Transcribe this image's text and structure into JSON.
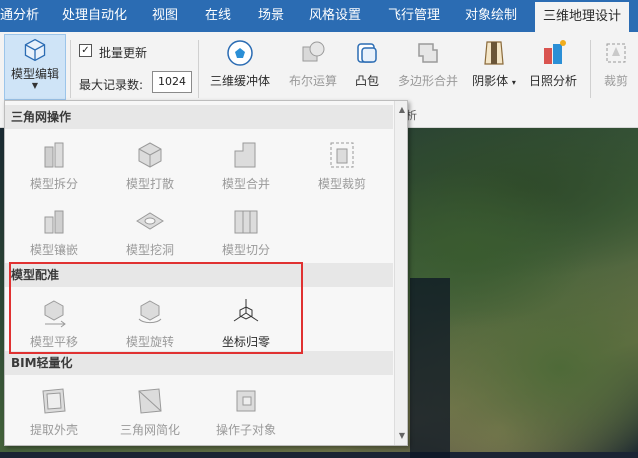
{
  "tabs": [
    {
      "label": "通分析",
      "active": false
    },
    {
      "label": "处理自动化",
      "active": false
    },
    {
      "label": "视图",
      "active": false
    },
    {
      "label": "在线",
      "active": false
    },
    {
      "label": "场景",
      "active": false
    },
    {
      "label": "风格设置",
      "active": false
    },
    {
      "label": "飞行管理",
      "active": false
    },
    {
      "label": "对象绘制",
      "active": false
    },
    {
      "label": "三维地理设计",
      "active": true
    }
  ],
  "ribbon": {
    "model_edit_label": "模型编辑",
    "batch_update_label": "批量更新",
    "batch_update_checked": true,
    "max_records_label": "最大记录数:",
    "max_records_value": "1024",
    "group_label_suffix": "析",
    "buttons": [
      {
        "label": "三维缓冲体",
        "enabled": true,
        "icon": "buffer-icon"
      },
      {
        "label": "布尔运算",
        "enabled": false,
        "icon": "boolean-icon"
      },
      {
        "label": "凸包",
        "enabled": true,
        "icon": "convex-hull-icon"
      },
      {
        "label": "多边形合并",
        "enabled": false,
        "icon": "polygon-merge-icon"
      },
      {
        "label": "阴影体",
        "enabled": true,
        "icon": "shadow-volume-icon"
      },
      {
        "label": "日照分析",
        "enabled": true,
        "icon": "sunlight-icon"
      },
      {
        "label": "裁剪",
        "enabled": false,
        "icon": "clip-icon"
      }
    ]
  },
  "dropdown": {
    "sections": [
      {
        "title": "三角网操作",
        "items": [
          {
            "label": "模型拆分",
            "enabled": false,
            "icon": "model-split-icon"
          },
          {
            "label": "模型打散",
            "enabled": false,
            "icon": "model-explode-icon"
          },
          {
            "label": "模型合并",
            "enabled": false,
            "icon": "model-merge-icon"
          },
          {
            "label": "模型裁剪",
            "enabled": false,
            "icon": "model-clip-icon"
          },
          {
            "label": "模型镶嵌",
            "enabled": false,
            "icon": "model-inlay-icon"
          },
          {
            "label": "模型挖洞",
            "enabled": false,
            "icon": "model-hole-icon"
          },
          {
            "label": "模型切分",
            "enabled": false,
            "icon": "model-cut-icon"
          }
        ]
      },
      {
        "title": "模型配准",
        "items": [
          {
            "label": "模型平移",
            "enabled": false,
            "icon": "model-translate-icon"
          },
          {
            "label": "模型旋转",
            "enabled": false,
            "icon": "model-rotate-icon"
          },
          {
            "label": "坐标归零",
            "enabled": true,
            "icon": "coordinate-reset-icon"
          }
        ]
      },
      {
        "title": "BIM轻量化",
        "items": [
          {
            "label": "提取外壳",
            "enabled": false,
            "icon": "extract-shell-icon"
          },
          {
            "label": "三角网简化",
            "enabled": false,
            "icon": "mesh-simplify-icon"
          },
          {
            "label": "操作子对象",
            "enabled": false,
            "icon": "sub-object-icon"
          }
        ]
      }
    ]
  },
  "colors": {
    "tab_bar": "#2b6cb3",
    "highlight": "#e03131",
    "disabled_text": "#9a9a9a"
  }
}
